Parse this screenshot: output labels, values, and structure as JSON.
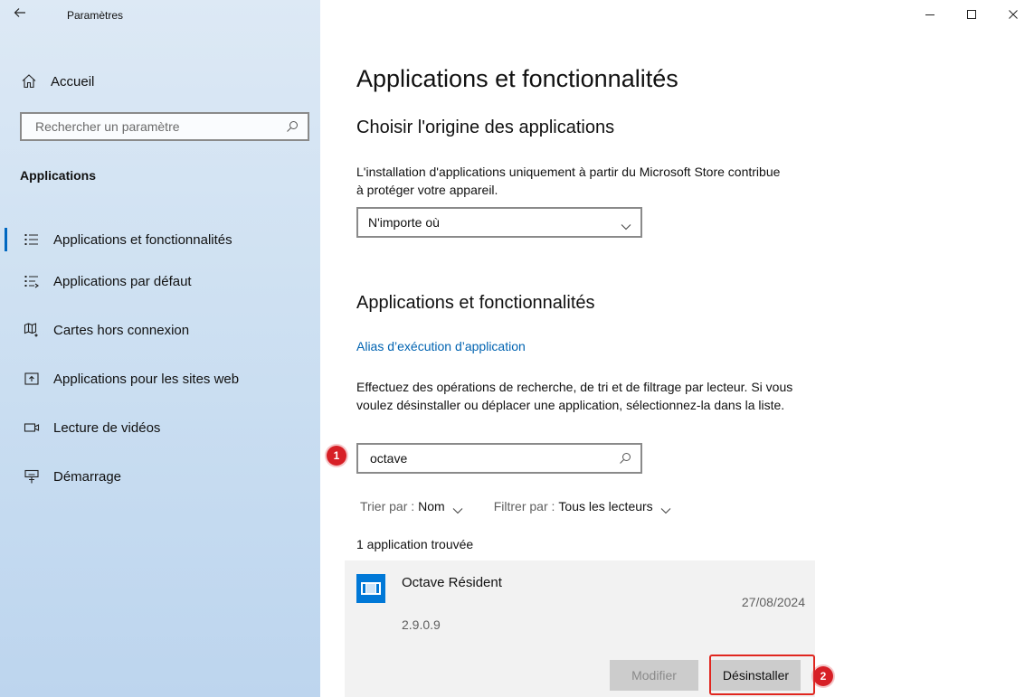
{
  "window": {
    "title": "Paramètres",
    "back_icon": "back-arrow-icon",
    "controls": [
      "minimize-icon",
      "maximize-icon",
      "close-icon"
    ]
  },
  "sidebar": {
    "home_label": "Accueil",
    "search_placeholder": "Rechercher un paramètre",
    "section_title": "Applications",
    "items": [
      {
        "label": "Applications et fonctionnalités",
        "icon": "apps-list-icon",
        "active": true
      },
      {
        "label": "Applications par défaut",
        "icon": "default-apps-icon",
        "active": false
      },
      {
        "label": "Cartes hors connexion",
        "icon": "offline-maps-icon",
        "active": false
      },
      {
        "label": "Applications pour les sites web",
        "icon": "web-apps-icon",
        "active": false
      },
      {
        "label": "Lecture de vidéos",
        "icon": "video-playback-icon",
        "active": false
      },
      {
        "label": "Démarrage",
        "icon": "startup-icon",
        "active": false
      }
    ]
  },
  "main": {
    "page_title": "Applications et fonctionnalités",
    "source": {
      "heading": "Choisir l'origine des applications",
      "description": "L'installation d'applications uniquement à partir du Microsoft Store contribue à protéger votre appareil.",
      "selected": "N'importe où"
    },
    "apps": {
      "heading": "Applications et fonctionnalités",
      "alias_link": "Alias d’exécution d’application",
      "description": "Effectuez des opérations de recherche, de tri et de filtrage par lecteur. Si vous voulez désinstaller ou déplacer une application, sélectionnez-la dans la liste.",
      "search_value": "octave",
      "sort_label": "Trier par :",
      "sort_value": "Nom",
      "filter_label": "Filtrer par :",
      "filter_value": "Tous les lecteurs",
      "result_count": "1 application trouvée",
      "list": [
        {
          "name": "Octave Résident",
          "date": "27/08/2024",
          "version": "2.9.0.9",
          "modify_label": "Modifier",
          "uninstall_label": "Désinstaller"
        }
      ]
    },
    "annotations": {
      "step1": "1",
      "step2": "2",
      "highlight_color": "#e0261f"
    }
  },
  "colors": {
    "accent": "#0067c0",
    "link": "#0063b1",
    "badge": "#d71f26"
  }
}
